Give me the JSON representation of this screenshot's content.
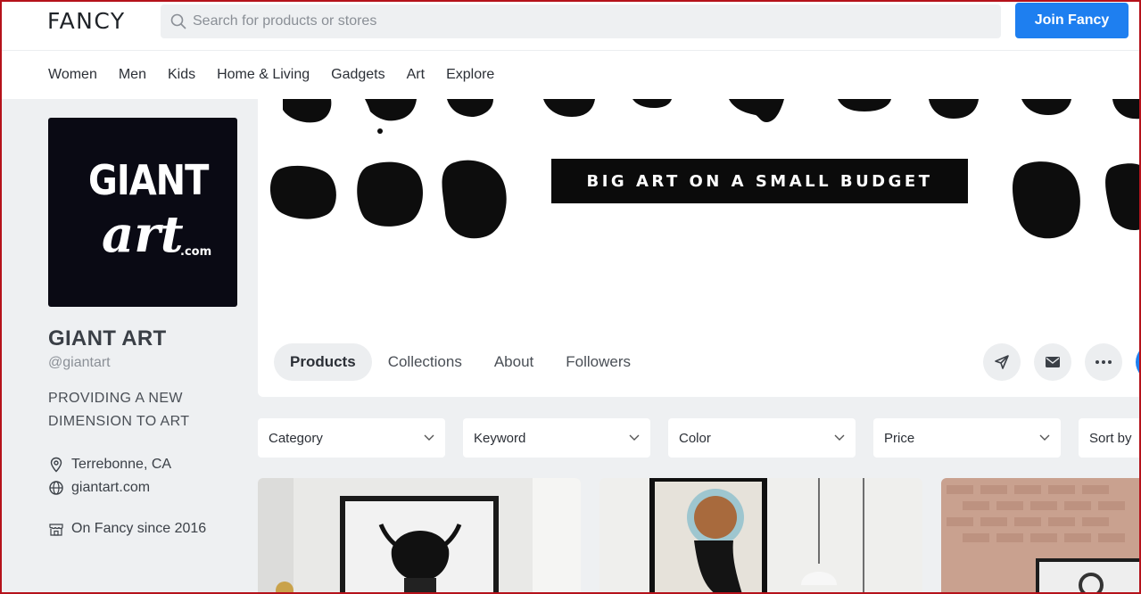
{
  "header": {
    "logo": "FANCY",
    "search_placeholder": "Search for products or stores",
    "join_label": "Join Fancy"
  },
  "nav": [
    "Women",
    "Men",
    "Kids",
    "Home & Living",
    "Gadgets",
    "Art",
    "Explore"
  ],
  "store": {
    "avatar_text": {
      "line1": "GIANT",
      "line2": "art",
      "suffix": ".com"
    },
    "name": "GIANT ART",
    "handle": "@giantart",
    "tagline": "PROVIDING A NEW DIMENSION TO ART",
    "location": "Terrebonne, CA",
    "website": "giantart.com",
    "since": "On Fancy since 2016"
  },
  "banner": {
    "text": "BIG ART ON A SMALL BUDGET"
  },
  "tabs": [
    "Products",
    "Collections",
    "About",
    "Followers"
  ],
  "active_tab": "Products",
  "actions": {
    "share_icon": "send-icon",
    "message_icon": "mail-icon",
    "more_icon": "more-icon",
    "follow_symbol": "+"
  },
  "filters": [
    "Category",
    "Keyword",
    "Color",
    "Price",
    "Sort by"
  ],
  "colors": {
    "accent": "#1e7ff0",
    "background": "#eef0f2"
  }
}
